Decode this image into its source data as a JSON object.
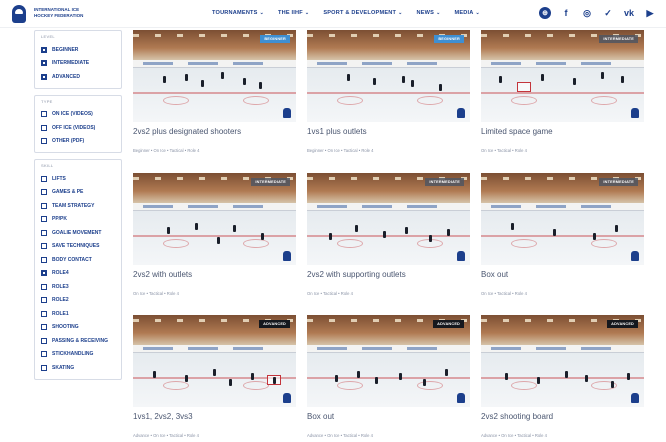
{
  "header": {
    "org_name": "International Ice Hockey Federation",
    "nav": [
      {
        "label": "TOURNAMENTS"
      },
      {
        "label": "THE IIHF"
      },
      {
        "label": "SPORT & DEVELOPMENT"
      },
      {
        "label": "NEWS"
      },
      {
        "label": "MEDIA"
      }
    ],
    "nav_chevron": "⌄",
    "social": [
      {
        "name": "website-icon",
        "glyph": "⊕"
      },
      {
        "name": "facebook-icon",
        "glyph": "f"
      },
      {
        "name": "instagram-icon",
        "glyph": "◎"
      },
      {
        "name": "twitter-icon",
        "glyph": "✓"
      },
      {
        "name": "vk-icon",
        "glyph": "vk"
      },
      {
        "name": "youtube-icon",
        "glyph": "▶"
      }
    ]
  },
  "filters": {
    "level": {
      "title": "LEVEL",
      "options": [
        {
          "label": "BEGINNER",
          "checked": true
        },
        {
          "label": "INTERMEDIATE",
          "checked": true
        },
        {
          "label": "ADVANCED",
          "checked": true
        }
      ]
    },
    "type": {
      "title": "TYPE",
      "options": [
        {
          "label": "ON ICE (VIDEOS)",
          "checked": false
        },
        {
          "label": "OFF ICE (VIDEOS)",
          "checked": false
        },
        {
          "label": "OTHER (PDF)",
          "checked": false
        }
      ]
    },
    "skill": {
      "title": "SKILL",
      "options": [
        {
          "label": "LIFTS",
          "checked": false
        },
        {
          "label": "GAMES & PE",
          "checked": false
        },
        {
          "label": "TEAM STRATEGY",
          "checked": false
        },
        {
          "label": "PP/PK",
          "checked": false
        },
        {
          "label": "GOALIE MOVEMENT",
          "checked": false
        },
        {
          "label": "SAVE TECHNIQUES",
          "checked": false
        },
        {
          "label": "BODY CONTACT",
          "checked": false
        },
        {
          "label": "ROLE4",
          "checked": true
        },
        {
          "label": "ROLE3",
          "checked": false
        },
        {
          "label": "ROLE2",
          "checked": false
        },
        {
          "label": "ROLE1",
          "checked": false
        },
        {
          "label": "SHOOTING",
          "checked": false
        },
        {
          "label": "PASSING & RECEIVING",
          "checked": false
        },
        {
          "label": "STICKHANDLING",
          "checked": false
        },
        {
          "label": "SKATING",
          "checked": false
        }
      ]
    }
  },
  "cards": [
    {
      "title": "2vs2 plus designated shooters",
      "meta": "Beginner • On Ice • Tactical • Role 4",
      "badge": "BEGINNER",
      "badge_style": "adv"
    },
    {
      "title": "1vs1 plus outlets",
      "meta": "Beginner • On Ice • Tactical • Role 4",
      "badge": "BEGINNER",
      "badge_style": "adv"
    },
    {
      "title": "Limited space game",
      "meta": "On Ice • Tactical • Role 4",
      "badge": "INTERMEDIATE",
      "badge_style": "int"
    },
    {
      "title": "2vs2 with outlets",
      "meta": "On Ice • Tactical • Role 4",
      "badge": "INTERMEDIATE",
      "badge_style": "int"
    },
    {
      "title": "2vs2 with supporting outlets",
      "meta": "On Ice • Tactical • Role 4",
      "badge": "INTERMEDIATE",
      "badge_style": "int"
    },
    {
      "title": "Box out",
      "meta": "On Ice • Tactical • Role 4",
      "badge": "INTERMEDIATE",
      "badge_style": "int"
    },
    {
      "title": "1vs1, 2vs2, 3vs3",
      "meta": "Advance • On Ice • Tactical • Role 4",
      "badge": "ADVANCED",
      "badge_style": "dark"
    },
    {
      "title": "Box out",
      "meta": "Advance • On Ice • Tactical • Role 4",
      "badge": "ADVANCED",
      "badge_style": "dark"
    },
    {
      "title": "2vs2 shooting board",
      "meta": "Advance • On Ice • Tactical • Role 4",
      "badge": "ADVANCED",
      "badge_style": "dark"
    }
  ]
}
